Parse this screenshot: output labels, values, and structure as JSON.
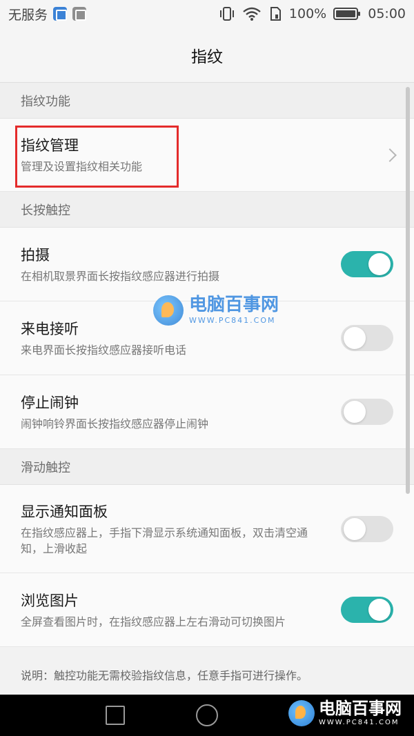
{
  "status_bar": {
    "carrier": "无服务",
    "battery_percent": "100%",
    "time": "05:00",
    "icons": [
      "health-app-icon",
      "gallery-app-icon",
      "vibrate-icon",
      "wifi-icon",
      "sim-icon",
      "battery-icon"
    ]
  },
  "header": {
    "title": "指纹"
  },
  "sections": [
    {
      "header": "指纹功能"
    },
    {
      "header": "长按触控"
    },
    {
      "header": "滑动触控"
    }
  ],
  "rows": {
    "fingerprint_manage": {
      "title": "指纹管理",
      "subtitle": "管理及设置指纹相关功能"
    },
    "capture": {
      "title": "拍摄",
      "subtitle": "在相机取景界面长按指纹感应器进行拍摄",
      "enabled": true
    },
    "answer_call": {
      "title": "来电接听",
      "subtitle": "来电界面长按指纹感应器接听电话",
      "enabled": false
    },
    "stop_alarm": {
      "title": "停止闹钟",
      "subtitle": "闹钟响铃界面长按指纹感应器停止闹钟",
      "enabled": false
    },
    "notification_panel": {
      "title": "显示通知面板",
      "subtitle": "在指纹感应器上，手指下滑显示系统通知面板，双击清空通知，上滑收起",
      "enabled": false
    },
    "browse_photos": {
      "title": "浏览图片",
      "subtitle": "全屏查看图片时，在指纹感应器上左右滑动可切换图片",
      "enabled": true
    }
  },
  "note": "说明：触控功能无需校验指纹信息，任意手指可进行操作。",
  "watermark": {
    "name": "电脑百事网",
    "url": "WWW.PC841.COM"
  },
  "colors": {
    "toggle_on": "#2bb3ac",
    "toggle_off": "#e1e1e1",
    "highlight": "#e42b2b"
  }
}
